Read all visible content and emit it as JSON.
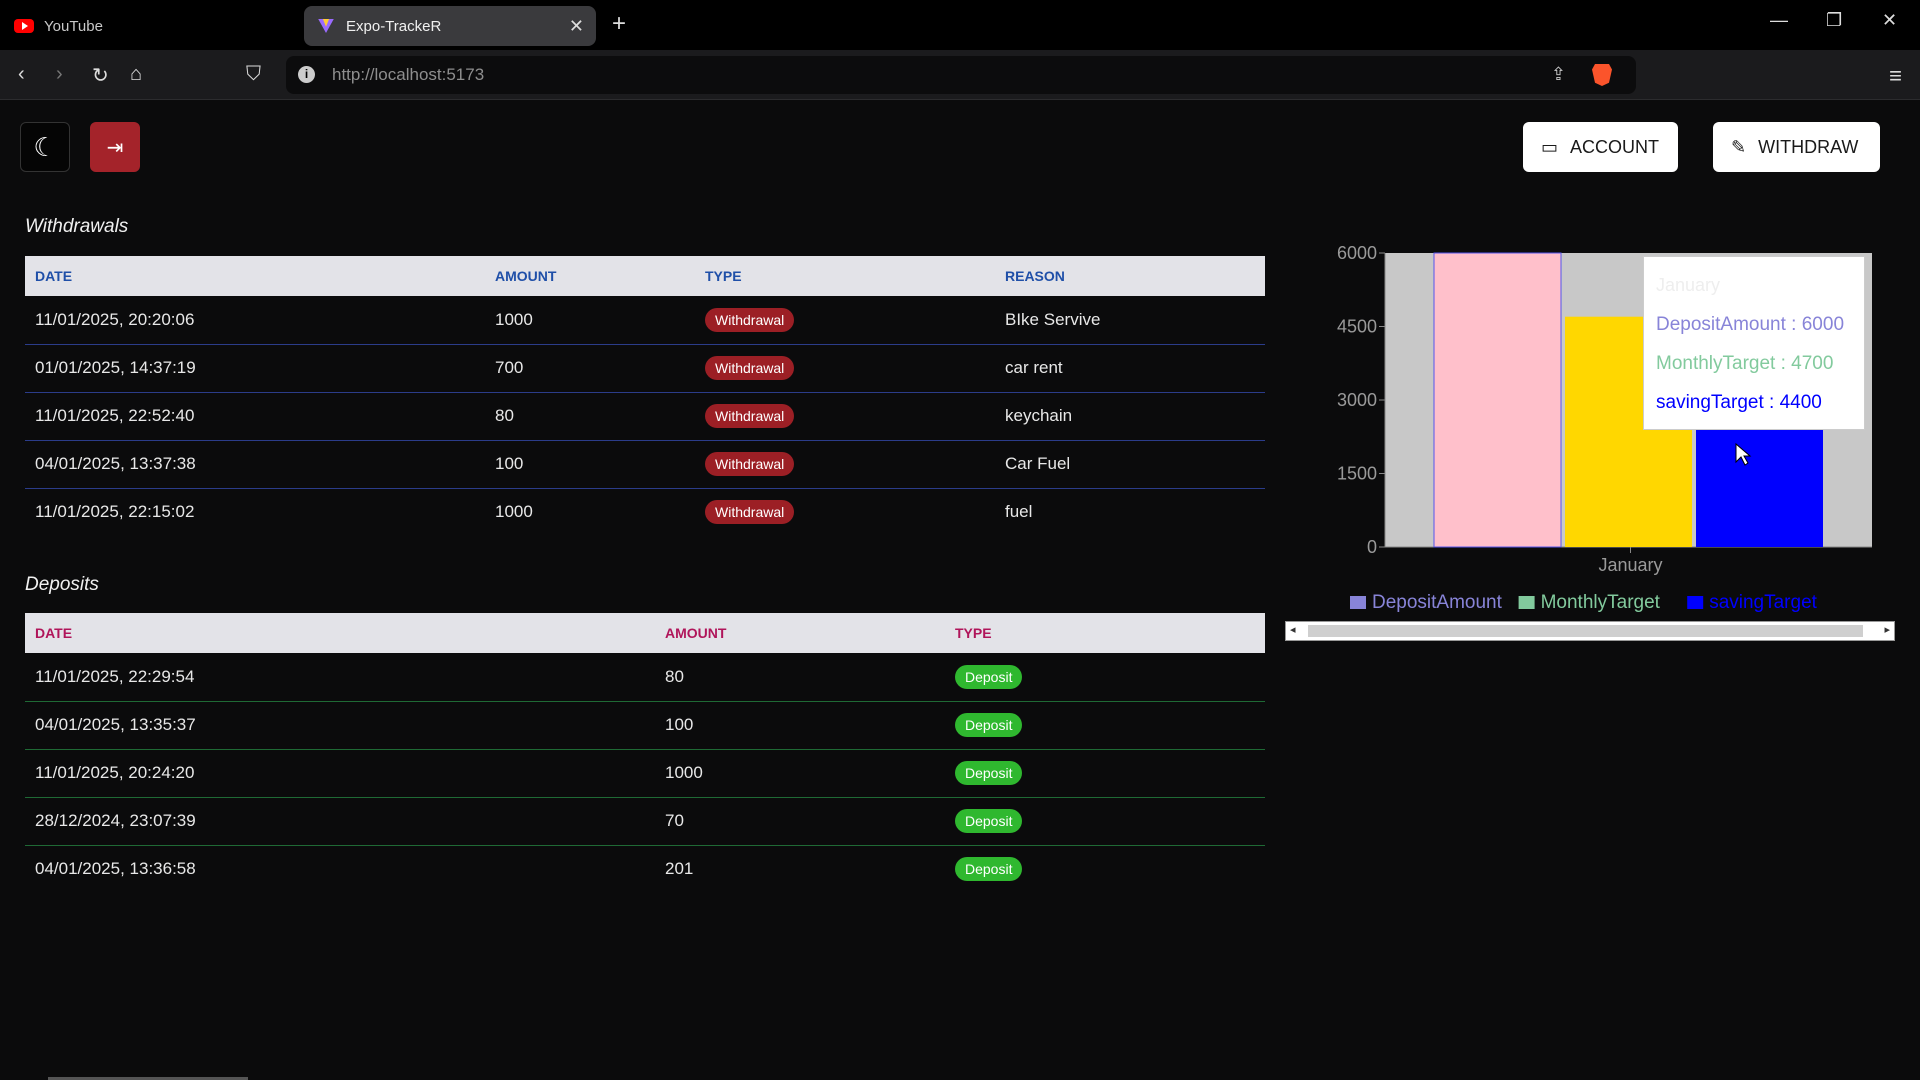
{
  "browser": {
    "tabs": [
      {
        "title": "YouTube",
        "active": false
      },
      {
        "title": "Expo-TrackeR",
        "active": true
      }
    ],
    "url": "http://localhost:5173"
  },
  "header": {
    "account_label": "ACCOUNT",
    "withdraw_label": "WITHDRAW"
  },
  "withdrawals": {
    "title": "Withdrawals",
    "columns": [
      "DATE",
      "AMOUNT",
      "TYPE",
      "REASON"
    ],
    "rows": [
      {
        "date": "11/01/2025, 20:20:06",
        "amount": "1000",
        "type": "Withdrawal",
        "reason": "BIke Servive"
      },
      {
        "date": "01/01/2025, 14:37:19",
        "amount": "700",
        "type": "Withdrawal",
        "reason": "car rent"
      },
      {
        "date": "11/01/2025, 22:52:40",
        "amount": "80",
        "type": "Withdrawal",
        "reason": "keychain"
      },
      {
        "date": "04/01/2025, 13:37:38",
        "amount": "100",
        "type": "Withdrawal",
        "reason": "Car Fuel"
      },
      {
        "date": "11/01/2025, 22:15:02",
        "amount": "1000",
        "type": "Withdrawal",
        "reason": "fuel"
      }
    ]
  },
  "deposits": {
    "title": "Deposits",
    "columns": [
      "DATE",
      "AMOUNT",
      "TYPE"
    ],
    "rows": [
      {
        "date": "11/01/2025, 22:29:54",
        "amount": "80",
        "type": "Deposit"
      },
      {
        "date": "04/01/2025, 13:35:37",
        "amount": "100",
        "type": "Deposit"
      },
      {
        "date": "11/01/2025, 20:24:20",
        "amount": "1000",
        "type": "Deposit"
      },
      {
        "date": "28/12/2024, 23:07:39",
        "amount": "70",
        "type": "Deposit"
      },
      {
        "date": "04/01/2025, 13:36:58",
        "amount": "201",
        "type": "Deposit"
      }
    ]
  },
  "chart_data": {
    "type": "bar",
    "categories": [
      "January"
    ],
    "series": [
      {
        "name": "DepositAmount",
        "values": [
          6000
        ],
        "color": "#ffc0cb",
        "legend_color": "#8884d8"
      },
      {
        "name": "MonthlyTarget",
        "values": [
          4700
        ],
        "color": "#ffd700",
        "legend_color": "#82ca9d"
      },
      {
        "name": "savingTarget",
        "values": [
          4400
        ],
        "color": "#0000ff",
        "legend_color": "#0000ff"
      }
    ],
    "yticks": [
      "0",
      "1500",
      "3000",
      "4500",
      "6000"
    ],
    "ylim": [
      0,
      6000
    ],
    "legend": "bottom",
    "tooltip": {
      "title": "January",
      "rows": [
        {
          "text": "DepositAmount : 6000",
          "color": "#8884d8"
        },
        {
          "text": "MonthlyTarget : 4700",
          "color": "#82ca9d"
        },
        {
          "text": "savingTarget : 4400",
          "color": "#0000ff"
        }
      ]
    }
  }
}
